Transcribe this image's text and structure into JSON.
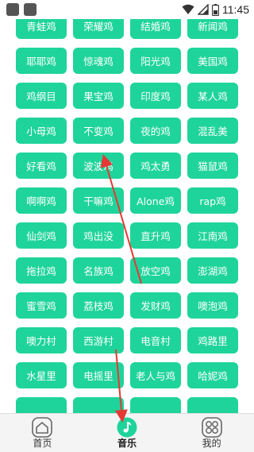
{
  "status_bar": {
    "time": "11:45",
    "icons": [
      "wifi-icon",
      "signal-icon",
      "battery-icon"
    ]
  },
  "colors": {
    "tile": "#1fd49a",
    "tile_text": "#ffffff",
    "nav_bg": "#f4f4f4",
    "accent": "#1fd49a",
    "annotation": "#e53935"
  },
  "grid": {
    "columns": 4,
    "tiles": [
      "青蛙鸡",
      "荣耀鸡",
      "结婚鸡",
      "新闻鸡",
      "耶耶鸡",
      "惊魂鸡",
      "阳光鸡",
      "美国鸡",
      "鸡纲目",
      "果宝鸡",
      "印度鸡",
      "某人鸡",
      "小母鸡",
      "不变鸡",
      "夜的鸡",
      "混乱美",
      "好看鸡",
      "波波鸡",
      "鸡太勇",
      "猫鼠鸡",
      "啊啊鸡",
      "干嘛鸡",
      "Alone鸡",
      "rap鸡",
      "仙剑鸡",
      "鸡出没",
      "直升鸡",
      "江南鸡",
      "拖拉鸡",
      "名族鸡",
      "放空鸡",
      "澎湖鸡",
      "蜜雪鸡",
      "荔枝鸡",
      "发财鸡",
      "噢泡鸡",
      "噢力村",
      "西游村",
      "电音村",
      "鸡路里",
      "水星里",
      "电摇里",
      "老人与鸡",
      "哈妮鸡",
      "",
      "",
      "",
      ""
    ]
  },
  "bottom_nav": {
    "items": [
      {
        "label": "首页",
        "icon": "home-icon",
        "active": false
      },
      {
        "label": "音乐",
        "icon": "music-note-icon",
        "active": true
      },
      {
        "label": "我的",
        "icon": "grid-apps-icon",
        "active": false
      }
    ]
  }
}
